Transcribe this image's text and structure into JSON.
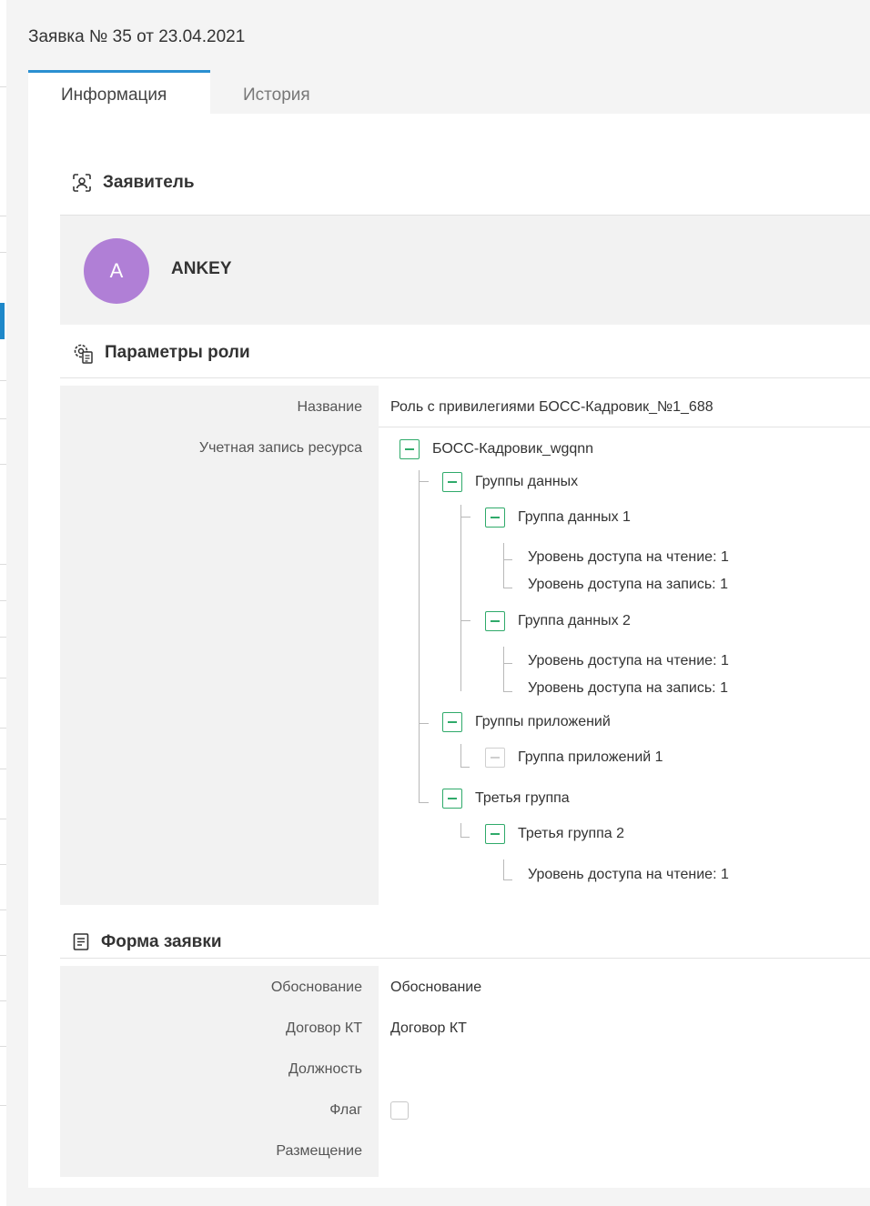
{
  "window": {
    "title": "Заявка № 35 от 23.04.2021"
  },
  "tabs": [
    {
      "label": "Информация",
      "active": true
    },
    {
      "label": "История",
      "active": false
    }
  ],
  "applicant": {
    "section_title": "Заявитель",
    "icon": "person-scan-icon",
    "avatar_letter": "A",
    "avatar_color": "#b07fd6",
    "name": "ANKEY"
  },
  "role_params": {
    "section_title": "Параметры роли",
    "icon": "settings-doc-icon",
    "name_label": "Название",
    "name_value": "Роль с привилегиями БОСС-Кадровик_№1_688",
    "account_label": "Учетная запись ресурса",
    "tree": {
      "root": "БОСС-Кадровик_wgqnn",
      "data_groups": "Группы данных",
      "data_group_1": "Группа данных 1",
      "dg1_read": "Уровень доступа на чтение: 1",
      "dg1_write": "Уровень доступа на запись: 1",
      "data_group_2": "Группа данных 2",
      "dg2_read": "Уровень доступа на чтение: 1",
      "dg2_write": "Уровень доступа на запись: 1",
      "app_groups": "Группы приложений",
      "app_group_1": "Группа приложений 1",
      "third_group": "Третья группа",
      "third_group_2": "Третья группа 2",
      "tg2_read": "Уровень доступа на чтение: 1"
    }
  },
  "request_form": {
    "section_title": "Форма заявки",
    "icon": "form-doc-icon",
    "fields": {
      "justification_label": "Обоснование",
      "justification_value": "Обоснование",
      "contract_label": "Договор КТ",
      "contract_value": "Договор КТ",
      "position_label": "Должность",
      "position_value": "",
      "flag_label": "Флаг",
      "placement_label": "Размещение",
      "placement_value": ""
    }
  },
  "colors": {
    "accent": "#2a8fd1",
    "tree_toggle": "#2faa6a"
  }
}
